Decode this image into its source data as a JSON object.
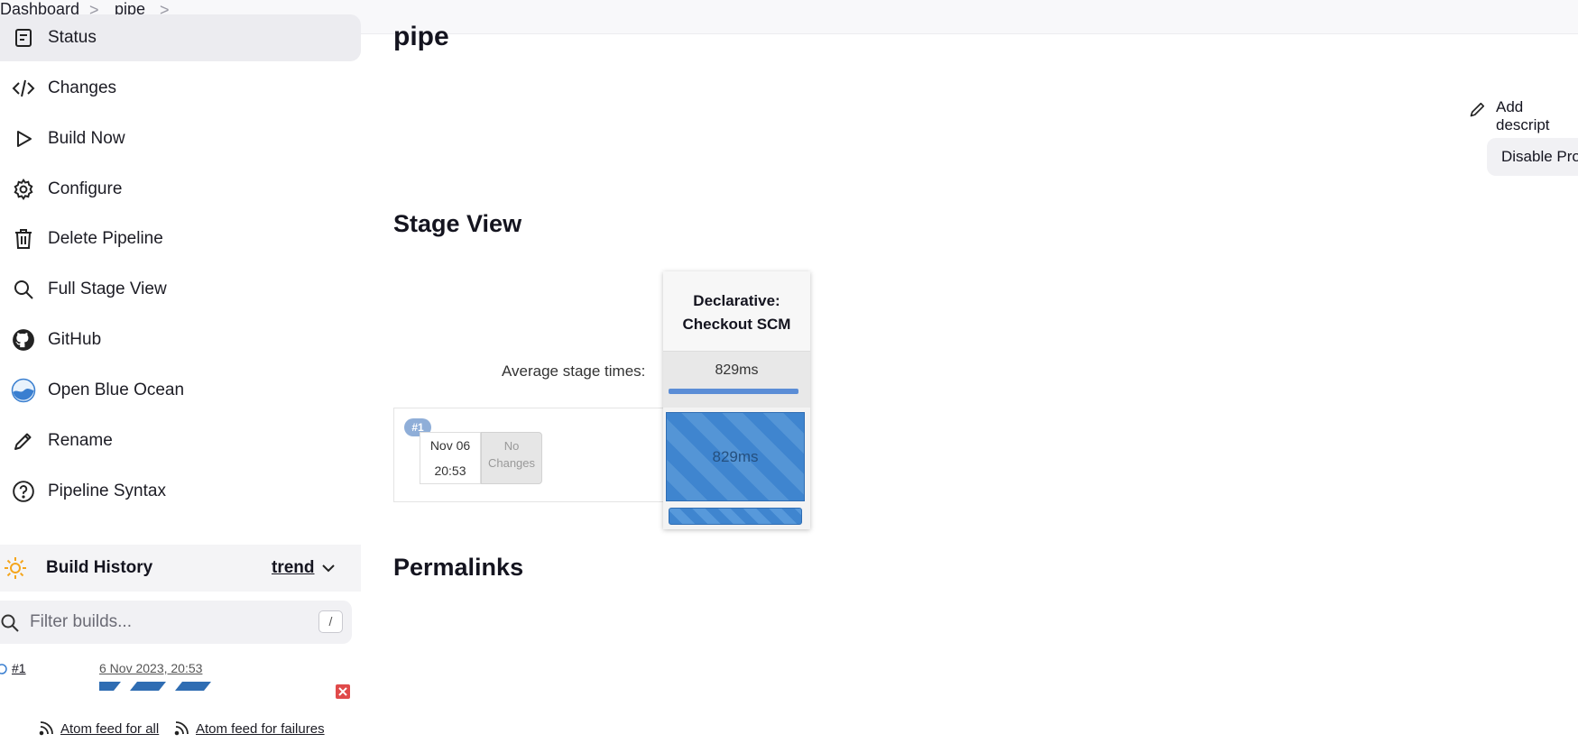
{
  "breadcrumb": {
    "items": [
      "Dashboard",
      "pipe"
    ],
    "separator": ">"
  },
  "sidebar": {
    "items": [
      {
        "label": "Status",
        "icon": "status-icon",
        "active": true
      },
      {
        "label": "Changes",
        "icon": "code-icon"
      },
      {
        "label": "Build Now",
        "icon": "play-icon"
      },
      {
        "label": "Configure",
        "icon": "gear-icon"
      },
      {
        "label": "Delete Pipeline",
        "icon": "trash-icon"
      },
      {
        "label": "Full Stage View",
        "icon": "search-icon"
      },
      {
        "label": "GitHub",
        "icon": "github-icon"
      },
      {
        "label": "Open Blue Ocean",
        "icon": "blue-ocean-icon"
      },
      {
        "label": "Rename",
        "icon": "pencil-icon"
      },
      {
        "label": "Pipeline Syntax",
        "icon": "help-icon"
      }
    ]
  },
  "build_history": {
    "title": "Build History",
    "trend_label": "trend",
    "filter_placeholder": "Filter builds...",
    "filter_shortcut": "/",
    "builds": [
      {
        "number": "#1",
        "date": "6 Nov 2023, 20:53"
      }
    ],
    "feeds": {
      "all": "Atom feed for all",
      "failures": "Atom feed for failures"
    }
  },
  "main": {
    "title": "pipe",
    "add_description": "Add descript",
    "disable_project": "Disable Proj",
    "stage_view_title": "Stage View",
    "permalinks_title": "Permalinks"
  },
  "stage_view": {
    "average_label": "Average stage times:",
    "stage": {
      "name_line1": "Declarative:",
      "name_line2": "Checkout SCM",
      "average": "829ms"
    },
    "runs": [
      {
        "badge": "#1",
        "date": "Nov 06",
        "time": "20:53",
        "changes_line1": "No",
        "changes_line2": "Changes",
        "duration": "829ms"
      }
    ]
  },
  "colors": {
    "stage_success": "#3f85cf",
    "accent_sun": "#f4a51c"
  }
}
